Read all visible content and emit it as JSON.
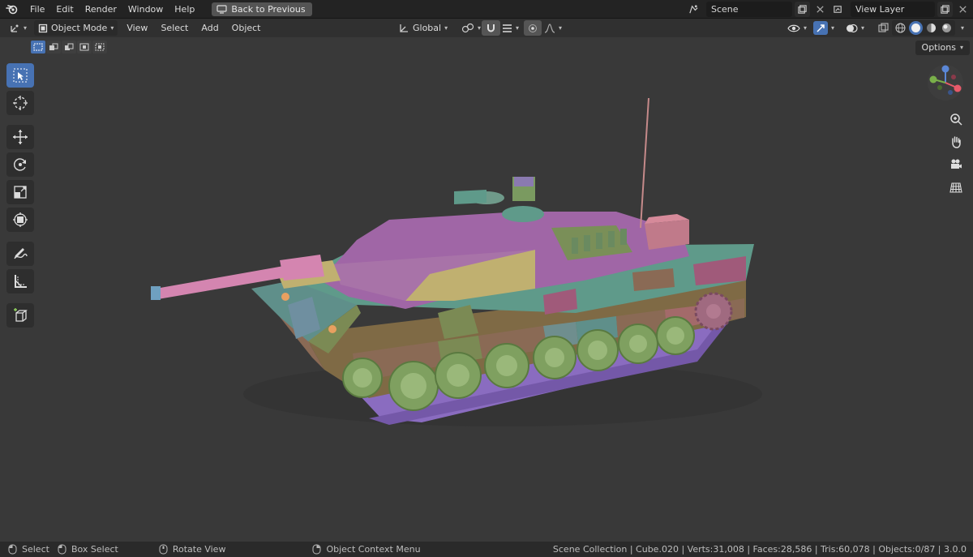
{
  "menu": {
    "items": [
      "File",
      "Edit",
      "Render",
      "Window",
      "Help"
    ],
    "back_button": "Back to Previous"
  },
  "scene": {
    "name": "Scene"
  },
  "view_layer": {
    "name": "View Layer"
  },
  "header": {
    "mode": "Object Mode",
    "view": "View",
    "select": "Select",
    "add": "Add",
    "object": "Object",
    "orientation": "Global"
  },
  "viewport": {
    "options_label": "Options"
  },
  "status": {
    "select": "Select",
    "box_select": "Box Select",
    "rotate_view": "Rotate View",
    "context_menu": "Object Context Menu",
    "stats": "Scene Collection | Cube.020 | Verts:31,008 | Faces:28,586 | Tris:60,078 | Objects:0/87 | 3.0.0"
  },
  "colors": {
    "accent": "#4772b3",
    "viewport_bg": "#393939"
  }
}
